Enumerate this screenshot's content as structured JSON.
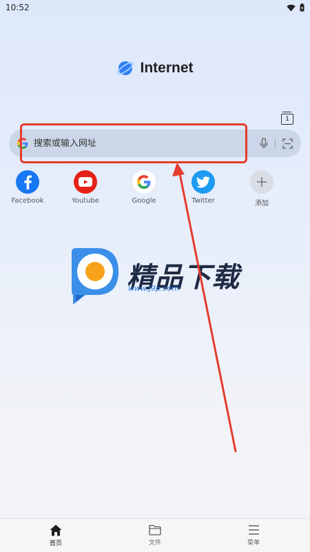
{
  "status_bar": {
    "time": "10:52"
  },
  "brand": {
    "name": "Internet"
  },
  "tabs": {
    "count": "1"
  },
  "search": {
    "placeholder": "搜索或输入网址"
  },
  "shortcuts": [
    {
      "label": "Facebook",
      "icon": "facebook-icon",
      "color": "#1877f2"
    },
    {
      "label": "Youtube",
      "icon": "youtube-icon",
      "color": "#e62117"
    },
    {
      "label": "Google",
      "icon": "google-icon",
      "color": "#ffffff"
    },
    {
      "label": "Twitter",
      "icon": "twitter-icon",
      "color": "#1d9bf0"
    },
    {
      "label": "添加",
      "icon": "plus-icon",
      "color": "#d9dde6"
    }
  ],
  "watermark": {
    "title": "精品下载",
    "url": "www.j9p.com"
  },
  "bottom_nav": [
    {
      "label": "首页",
      "icon": "home-icon"
    },
    {
      "label": "文件",
      "icon": "folder-icon"
    },
    {
      "label": "菜单",
      "icon": "menu-icon"
    }
  ],
  "colors": {
    "annotation": "#e53b2c",
    "search_bg": "#cbd6e8"
  }
}
